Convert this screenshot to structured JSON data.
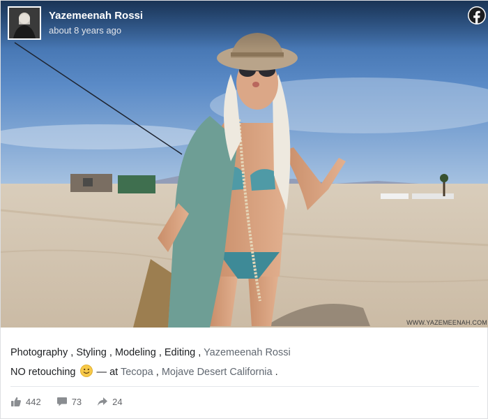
{
  "post": {
    "author": "Yazemeenah Rossi",
    "timestamp": "about 8 years ago",
    "watermark": "WWW.YAZEMEENAH.COM",
    "caption_line1": {
      "tags": [
        "Photography",
        "Styling",
        "Modeling",
        "Editing"
      ],
      "separator": " , ",
      "mention": "Yazemeenah Rossi"
    },
    "caption_line2": {
      "prefix": "NO retouching",
      "at_text": " — at ",
      "place1": "Tecopa",
      "place_separator": " , ",
      "place2": "Mojave Desert California",
      "suffix": " ."
    },
    "stats": {
      "likes": "442",
      "comments": "73",
      "shares": "24"
    }
  },
  "colors": {
    "facebook_blue": "#1877f2",
    "link_gray": "#606770",
    "stat_gray": "#65676b"
  },
  "icons": [
    "facebook-logo-icon",
    "smiley-emoji-icon",
    "like-thumb-icon",
    "comment-icon",
    "share-arrow-icon"
  ]
}
